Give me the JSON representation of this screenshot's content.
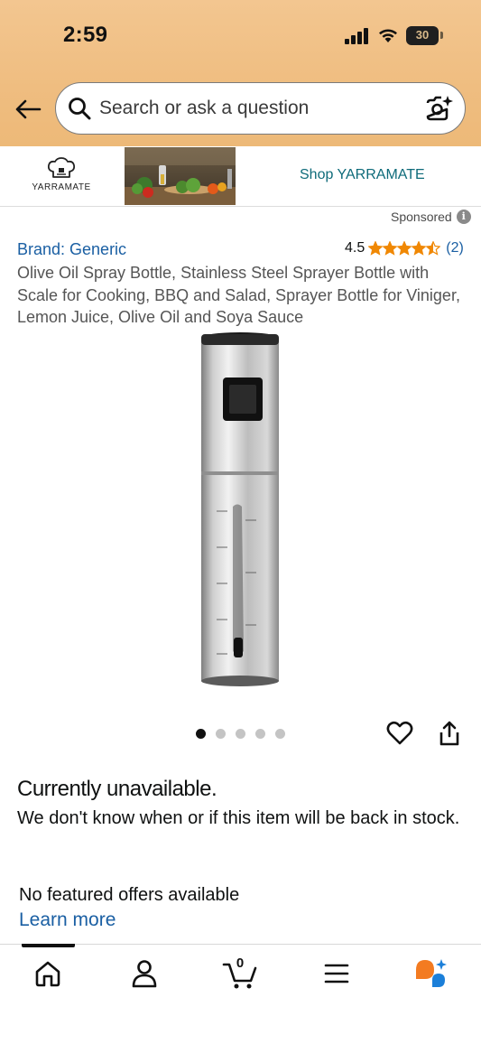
{
  "status_bar": {
    "time": "2:59",
    "battery": "30"
  },
  "search": {
    "placeholder": "Search or ask a question",
    "value": ""
  },
  "brand_strip": {
    "logo_text": "YARRAMATE",
    "shop_link": "Shop YARRAMATE"
  },
  "sponsored": {
    "label": "Sponsored",
    "info_glyph": "i"
  },
  "product": {
    "brand": "Brand: Generic",
    "rating_value": "4.5",
    "rating_stars": 4.5,
    "rating_count": "(2)",
    "title": "Olive Oil Spray Bottle, Stainless Steel Sprayer Bottle with Scale for Cooking, BBQ and Salad, Sprayer Bottle for Viniger, Lemon Juice, Olive Oil and Soya Sauce",
    "image_count": 5,
    "active_image": 1
  },
  "availability": {
    "heading": "Currently unavailable.",
    "detail": "We don't know when or if this item will be back in stock."
  },
  "offers": {
    "text": "No featured offers available",
    "learn_more": "Learn more"
  },
  "nav": {
    "cart_count": "0",
    "items": [
      "home-icon",
      "account-icon",
      "cart-icon",
      "menu-icon",
      "rufus-icon"
    ]
  },
  "colors": {
    "header_orange": "#efbd80",
    "link_blue": "#1a5fa3",
    "teal_link": "#0e6b7a",
    "star_orange": "#f08804",
    "rufus_orange": "#f37b21",
    "rufus_blue": "#1b7fd9"
  }
}
